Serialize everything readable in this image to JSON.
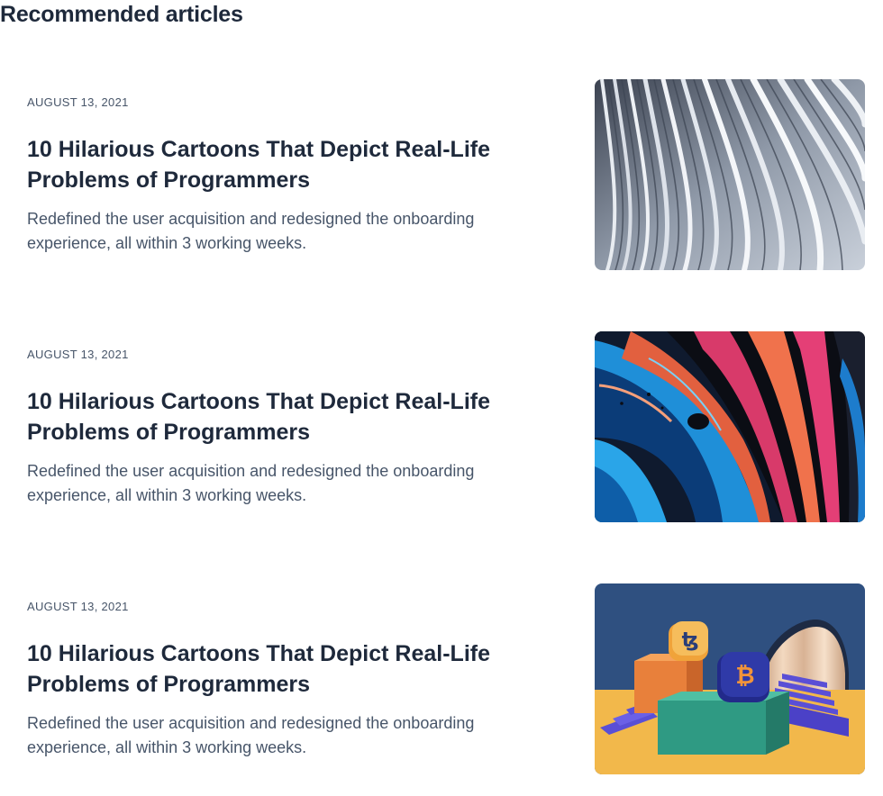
{
  "section": {
    "title": "Recommended articles"
  },
  "articles": [
    {
      "date": "AUGUST 13, 2021",
      "title": "10 Hilarious Cartoons That Depict Real-Life Problems of Programmers",
      "description": "Redefined the user acquisition and redesigned the onboarding experience, all within 3 working weeks."
    },
    {
      "date": "AUGUST 13, 2021",
      "title": "10 Hilarious Cartoons That Depict Real-Life Problems of Programmers",
      "description": "Redefined the user acquisition and redesigned the onboarding experience, all within 3 working weeks."
    },
    {
      "date": "AUGUST 13, 2021",
      "title": "10 Hilarious Cartoons That Depict Real-Life Problems of Programmers",
      "description": "Redefined the user acquisition and redesigned the onboarding experience, all within 3 working weeks."
    }
  ],
  "images": {
    "image_1": "abstract-architecture-curves-photo",
    "image_2": "fluid-paint-abstract-photo",
    "image_3": "crypto-coins-3d-render-illustration"
  },
  "colors": {
    "heading": "#1e293b",
    "body_text": "#475569"
  }
}
